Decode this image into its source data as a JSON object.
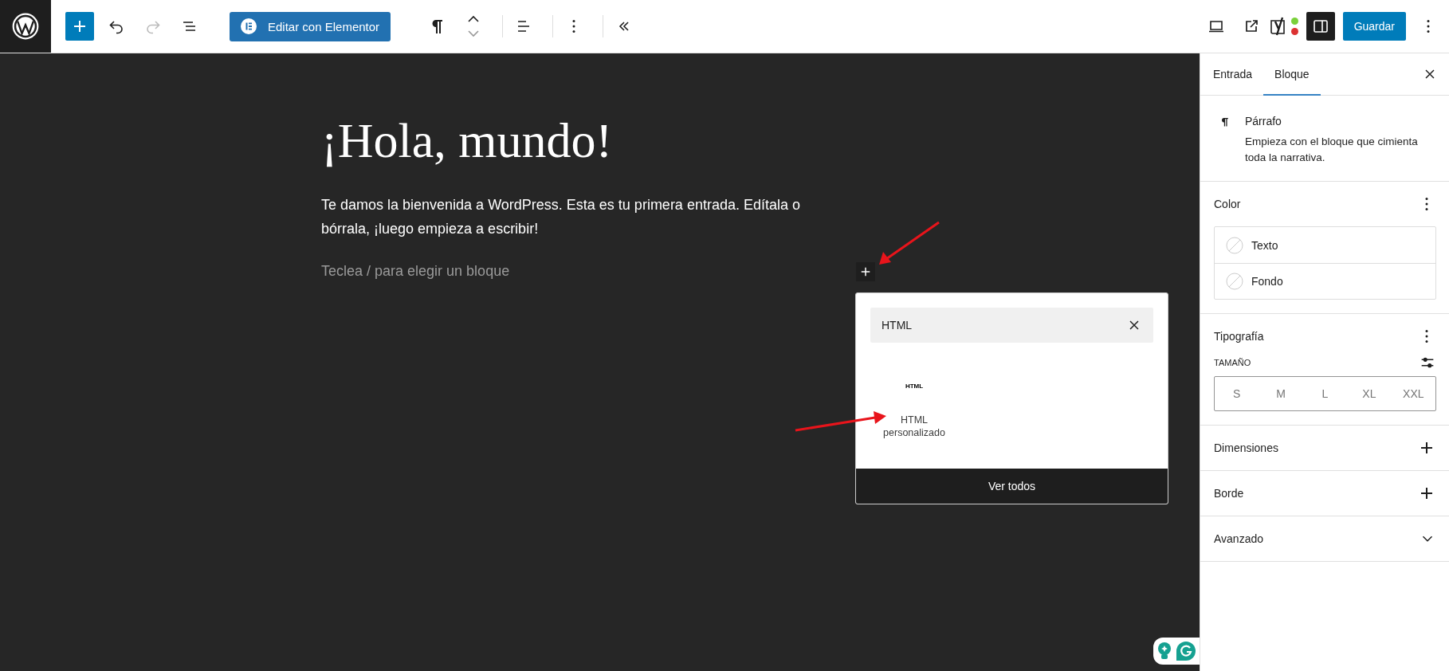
{
  "toolbar": {
    "tools": [
      {
        "kind": "inserter",
        "disabled": false
      },
      {
        "kind": "undo",
        "disabled": false
      },
      {
        "kind": "redo",
        "disabled": true
      },
      {
        "kind": "list-view",
        "disabled": false
      }
    ],
    "elementor_button": "Editar con Elementor",
    "seo_dots": [
      {
        "color": "#7ad03a"
      },
      {
        "color": "#dc3232"
      }
    ],
    "settings_toggle": {
      "pressed": true
    },
    "save_button": "Guardar"
  },
  "editor": {
    "title": "¡Hola, mundo!",
    "paragraph": "Te damos la bienvenida a WordPress. Esta es tu primera entrada. Edítala o bórrala, ¡luego empieza a escribir!",
    "placeholder": "Teclea / para elegir un bloque"
  },
  "inserter": {
    "search": {
      "value": "HTML"
    },
    "results": [
      {
        "icon_label": "HTML",
        "label": "HTML personalizado"
      }
    ],
    "view_all": "Ver todos"
  },
  "sidebar": {
    "tabs": [
      {
        "label": "Entrada",
        "selected": false
      },
      {
        "label": "Bloque",
        "selected": true
      }
    ],
    "block": {
      "name": "Párrafo",
      "description": "Empieza con el bloque que cimienta toda la narrativa."
    },
    "panels": [
      {
        "kind": "color",
        "title": "Color",
        "items": [
          "Texto",
          "Fondo"
        ]
      },
      {
        "kind": "typography",
        "title": "Tipografía",
        "size_label": "TAMAÑO",
        "sizes": [
          {
            "label": "S",
            "selected": false
          },
          {
            "label": "M",
            "selected": false
          },
          {
            "label": "L",
            "selected": false
          },
          {
            "label": "XL",
            "selected": false
          },
          {
            "label": "XXL",
            "selected": false
          }
        ]
      },
      {
        "kind": "addable",
        "title": "Dimensiones"
      },
      {
        "kind": "addable",
        "title": "Borde"
      },
      {
        "kind": "collapsible",
        "title": "Avanzado",
        "expanded": false
      }
    ]
  }
}
